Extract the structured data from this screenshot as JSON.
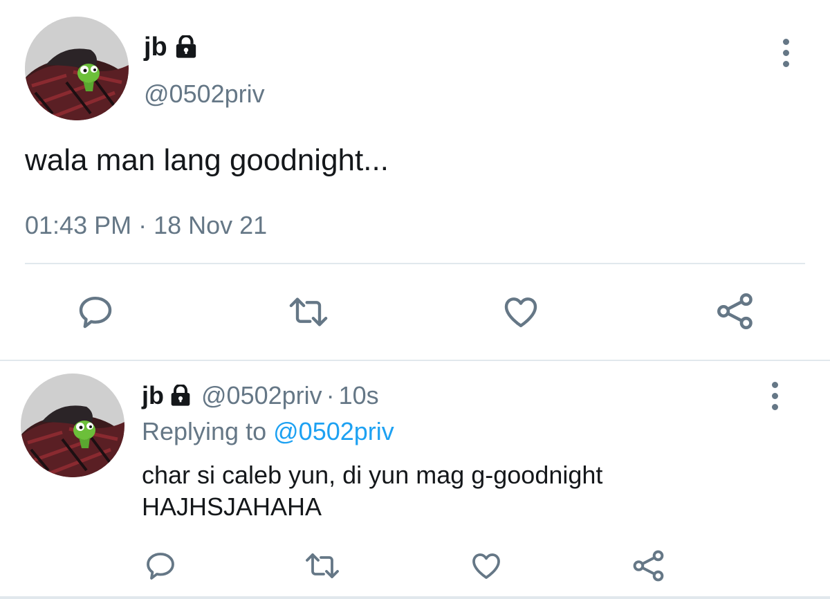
{
  "main_tweet": {
    "display_name": "jb",
    "handle": "@0502priv",
    "text": "wala man lang goodnight...",
    "timestamp": "01:43 PM · 18 Nov 21",
    "avatar_icon": "kermit-avatar",
    "lock_icon": "lock-icon",
    "more_icon": "more-vertical-icon",
    "actions": [
      "reply-icon",
      "retweet-icon",
      "like-icon",
      "share-icon"
    ]
  },
  "reply_tweet": {
    "display_name": "jb",
    "handle": "@0502priv",
    "separator": "·",
    "time_ago": "10s",
    "replying_prefix": "Replying to",
    "replying_to": "@0502priv",
    "text_line1": "char si caleb yun, di yun mag g-goodnight",
    "text_line2": "HAJHSJAHAHA",
    "avatar_icon": "kermit-avatar",
    "lock_icon": "lock-icon",
    "more_icon": "more-vertical-icon",
    "actions": [
      "reply-icon",
      "retweet-icon",
      "like-icon",
      "share-icon"
    ]
  },
  "colors": {
    "text": "#14171a",
    "secondary": "#657786",
    "link": "#1da1f2",
    "divider": "#e1e8ed"
  }
}
